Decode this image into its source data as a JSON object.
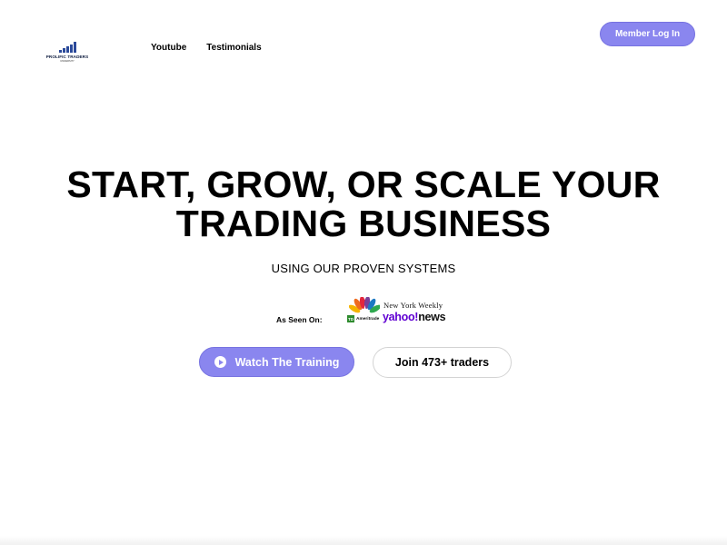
{
  "header": {
    "logo": {
      "name": "PROLIFIC TRADERS",
      "subtitle": "UNIVERSITY"
    },
    "nav": [
      {
        "label": "Youtube"
      },
      {
        "label": "Testimonials"
      }
    ],
    "member_login_label": "Member Log In"
  },
  "hero": {
    "headline_line1": "START, GROW, OR SCALE YOUR",
    "headline_line2": "TRADING BUSINESS",
    "subheadline": "USING OUR PROVEN SYSTEMS",
    "as_seen_on_label": "As Seen On:",
    "press": {
      "nyw": "New York Weekly",
      "td_mark": "TD",
      "ameritrade": "Ameritrade",
      "yahoo": "yahoo!",
      "news": "news"
    },
    "watch_button_label": "Watch The Training",
    "join_button_label": "Join 473+ traders"
  },
  "icons": {
    "logo": "bar-chart-logo",
    "watch": "play-circle-icon",
    "press_peacock": "nbc-peacock-icon"
  },
  "colors": {
    "accent": "#8a86ef",
    "yahoo": "#6001d2",
    "td_green": "#2e8b2e",
    "logo_blue": "#2b4a9a"
  }
}
